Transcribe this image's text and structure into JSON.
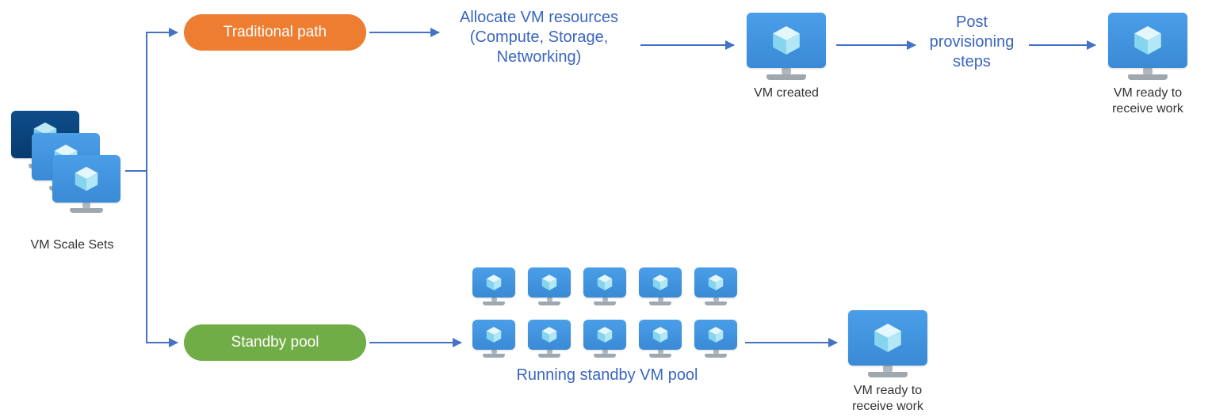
{
  "source": {
    "label": "VM Scale Sets"
  },
  "paths": {
    "traditional": {
      "pill": "Traditional path",
      "allocate_l1": "Allocate VM resources",
      "allocate_l2": "(Compute, Storage,",
      "allocate_l3": "Networking)",
      "vm_created_label": "VM created",
      "post_l1": "Post",
      "post_l2": "provisioning",
      "post_l3": "steps",
      "ready_l1": "VM ready to",
      "ready_l2": "receive work"
    },
    "standby": {
      "pill": "Standby pool",
      "pool_label": "Running standby VM pool",
      "ready_l1": "VM ready to",
      "ready_l2": "receive work"
    }
  },
  "colors": {
    "blue_text": "#3a66c0",
    "arrow": "#4472c4",
    "pill_orange": "#ed7d31",
    "pill_green": "#70ad47",
    "screen_light": "#4a9ee8",
    "screen_dark": "#0e4d8a"
  }
}
